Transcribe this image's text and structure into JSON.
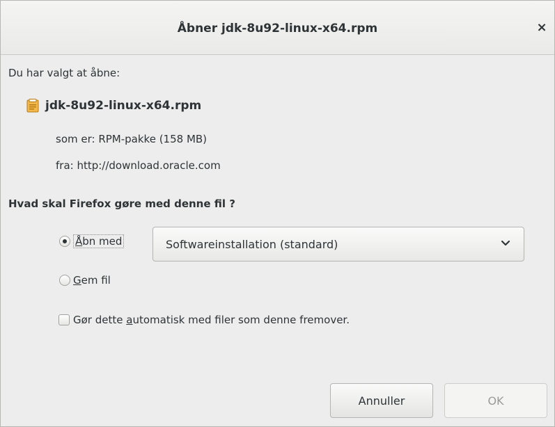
{
  "dialog": {
    "title": "Åbner jdk-8u92-linux-x64.rpm",
    "close_label": "×"
  },
  "content": {
    "intro": "Du har valgt at åbne:",
    "file_name": "jdk-8u92-linux-x64.rpm",
    "file_type": "som er: RPM-pakke (158 MB)",
    "file_source": "fra: http://download.oracle.com",
    "question": "Hvad skal Firefox gøre med denne fil ?"
  },
  "options": {
    "open_with": {
      "mnemonic": "Å",
      "rest": "bn med",
      "checked": true
    },
    "app_select": {
      "value": "Softwareinstallation (standard)"
    },
    "save_file": {
      "mnemonic": "G",
      "rest": "em fil",
      "checked": false
    },
    "auto": {
      "prefix": "Gør dette ",
      "mnemonic": "a",
      "rest": "utomatisk med filer som denne fremover.",
      "checked": false
    }
  },
  "buttons": {
    "cancel": "Annuller",
    "ok": "OK"
  },
  "icons": {
    "file": "package-file-icon",
    "chevron": "chevron-down-icon"
  },
  "colors": {
    "background": "#ededed",
    "text": "#2e3436",
    "file_icon": "#e6a12a"
  }
}
